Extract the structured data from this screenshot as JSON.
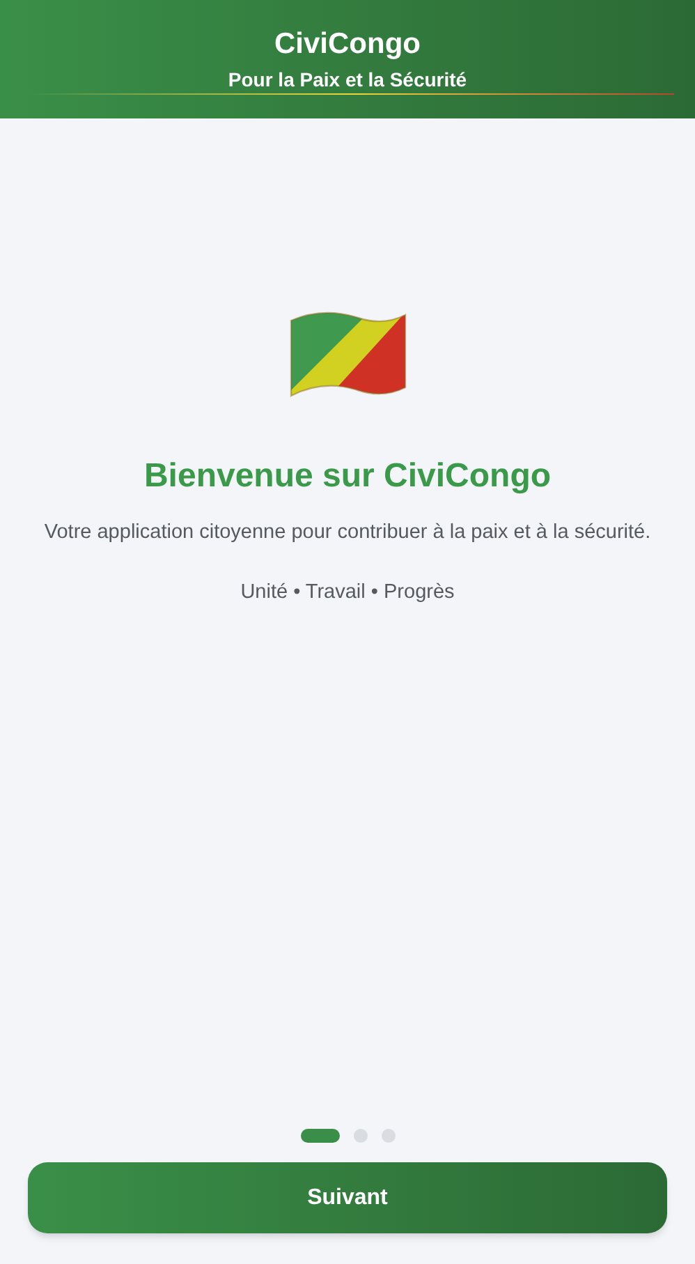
{
  "header": {
    "title": "CiviCongo",
    "subtitle": "Pour la Paix et la Sécurité"
  },
  "welcome": {
    "heading": "Bienvenue sur CiviCongo",
    "description": "Votre application citoyenne pour contribuer à la paix et à la sécurité.",
    "motto": "Unité • Travail • Progrès"
  },
  "pager": [
    {
      "selected": true
    },
    {
      "selected": false
    },
    {
      "selected": false
    }
  ],
  "next_button": "Suivant"
}
